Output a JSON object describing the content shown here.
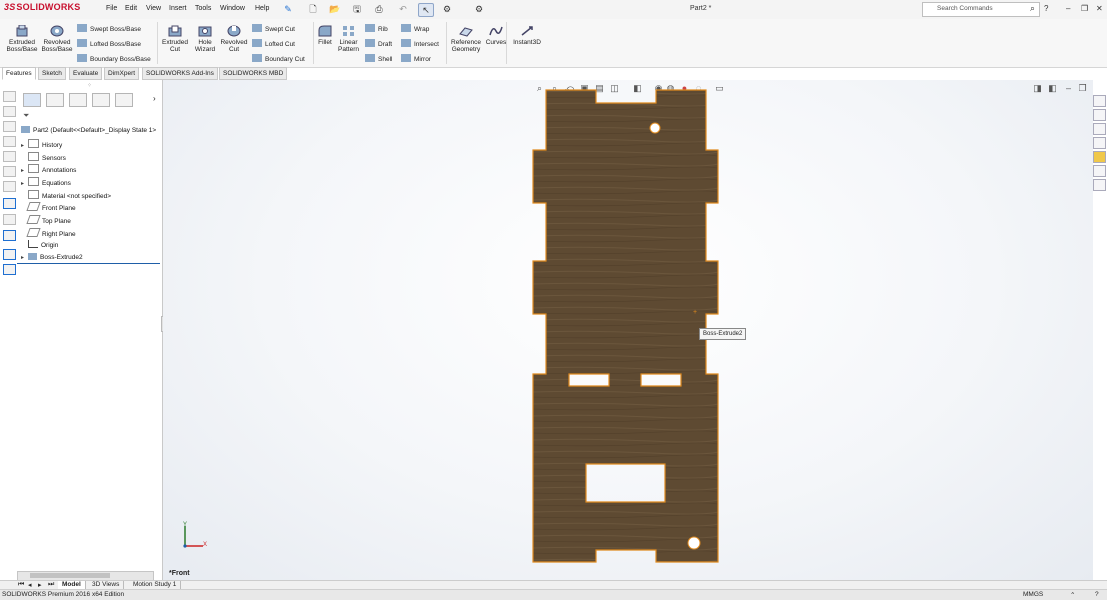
{
  "app": {
    "logo_text": "SOLIDWORKS",
    "logo_prefix": "3S",
    "document_title": "Part2 *",
    "search_placeholder": "Search Commands",
    "menus": [
      "File",
      "Edit",
      "View",
      "Insert",
      "Tools",
      "Window",
      "Help"
    ]
  },
  "ribbon": {
    "extruded_boss_base": "Extruded Boss/Base",
    "revolved_boss_base": "Revolved Boss/Base",
    "swept_boss_base": "Swept Boss/Base",
    "lofted_boss_base": "Lofted Boss/Base",
    "boundary_boss_base": "Boundary Boss/Base",
    "extruded_cut": "Extruded Cut",
    "hole_wizard": "Hole Wizard",
    "revolved_cut": "Revolved Cut",
    "swept_cut": "Swept Cut",
    "lofted_cut": "Lofted Cut",
    "boundary_cut": "Boundary Cut",
    "fillet": "Fillet",
    "linear_pattern": "Linear Pattern",
    "rib": "Rib",
    "draft": "Draft",
    "shell": "Shell",
    "wrap": "Wrap",
    "intersect": "Intersect",
    "mirror": "Mirror",
    "reference_geometry": "Reference Geometry",
    "curves": "Curves",
    "instant3d": "Instant3D"
  },
  "command_tabs": [
    "Features",
    "Sketch",
    "Evaluate",
    "DimXpert",
    "SOLIDWORKS Add-Ins",
    "SOLIDWORKS MBD"
  ],
  "active_command_tab": "Features",
  "tree": {
    "root": "Part2  (Default<<Default>_Display State 1>",
    "items": [
      {
        "label": "History",
        "expandable": true
      },
      {
        "label": "Sensors",
        "expandable": false
      },
      {
        "label": "Annotations",
        "expandable": true
      },
      {
        "label": "Equations",
        "expandable": true
      },
      {
        "label": "Material <not specified>",
        "expandable": false
      },
      {
        "label": "Front Plane",
        "expandable": false
      },
      {
        "label": "Top Plane",
        "expandable": false
      },
      {
        "label": "Right Plane",
        "expandable": false
      },
      {
        "label": "Origin",
        "expandable": false
      },
      {
        "label": "Boss-Extrude2",
        "expandable": true
      }
    ]
  },
  "viewport": {
    "view_name": "*Front",
    "tooltip": "Boss-Extrude2",
    "triad_y": "Y",
    "triad_x": "X"
  },
  "bottom_tabs": [
    "Model",
    "3D Views",
    "Motion Study 1"
  ],
  "active_bottom_tab": "Model",
  "status": {
    "edition": "SOLIDWORKS Premium 2016 x64 Edition",
    "units": "MMGS"
  },
  "colors": {
    "part_fill": "#5e4a32",
    "part_edge": "#e08a1e",
    "accent_red": "#c8102e"
  }
}
